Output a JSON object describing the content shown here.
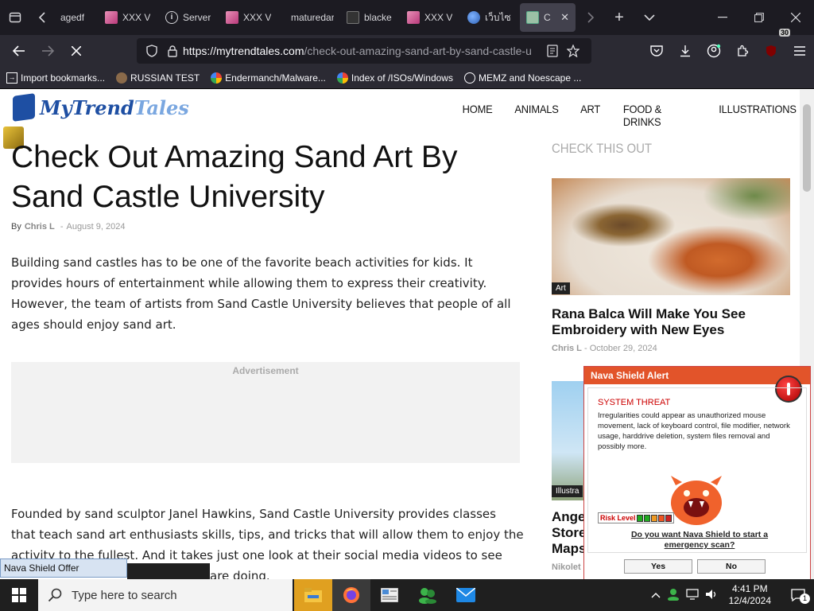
{
  "browser": {
    "tabs": [
      {
        "title": "agedf",
        "favicon": "none"
      },
      {
        "title": "XXX V",
        "favicon": "pink-image"
      },
      {
        "title": "Server",
        "favicon": "info-icon"
      },
      {
        "title": "XXX V",
        "favicon": "pink-image"
      },
      {
        "title": "maturedar",
        "favicon": "none"
      },
      {
        "title": "blacke",
        "favicon": "dark-image"
      },
      {
        "title": "XXX V",
        "favicon": "pink-image"
      },
      {
        "title": "เว็บไซ",
        "favicon": "globe"
      },
      {
        "title": "Che",
        "favicon": "image",
        "active": true
      }
    ],
    "url_host": "https://mytrendtales.com",
    "url_path": "/check-out-amazing-sand-art-by-sand-castle-u",
    "extension_badge": "30",
    "bookmarks": [
      {
        "label": "Import bookmarks...",
        "icon": "import-icon"
      },
      {
        "label": "RUSSIAN TEST",
        "icon": "circle-icon"
      },
      {
        "label": "Endermanch/Malware...",
        "icon": "google-icon"
      },
      {
        "label": "Index of /ISOs/Windows",
        "icon": "google-icon"
      },
      {
        "label": "MEMZ and Noescape ...",
        "icon": "globe-icon"
      }
    ]
  },
  "site": {
    "logo_part1": "MyTrend",
    "logo_part2": "Tales",
    "nav": [
      "HOME",
      "ANIMALS",
      "ART",
      "FOOD & DRINKS",
      "ILLUSTRATIONS"
    ]
  },
  "article": {
    "title": "Check Out Amazing Sand Art By Sand Castle University",
    "by": "By",
    "author": "Chris L",
    "sep": "-",
    "date": "August 9, 2024",
    "para1": "Building sand castles has to be one of the favorite beach activities for kids. It provides hours of entertainment while allowing them to express their creativity. However, the team of artists from Sand Castle University believes that people of all ages should enjoy sand art.",
    "ad_label": "Advertisement",
    "para2": "Founded by sand sculptor Janel Hawkins, Sand Castle University provides classes that teach sand art enthusiasts skills, tips, and tricks that will allow them to enjoy the activity to the fullest. And it takes just one look at their social media videos to see",
    "para2_tail": "are doing."
  },
  "sidebar": {
    "heading": "CHECK THIS OUT",
    "card1": {
      "tag": "Art",
      "title": "Rana Balca Will Make You See Embroidery with New Eyes",
      "author": "Chris L",
      "sep": "-",
      "date": "October 29, 2024"
    },
    "card2": {
      "tag": "Illustra",
      "title_lines": [
        "Ange",
        "Store",
        "Maps"
      ],
      "author": "Nikolet"
    }
  },
  "popup": {
    "title": "Nava Shield Alert",
    "threat": "SYSTEM THREAT",
    "description": "Irregularities could appear as unauthorized mouse movement, lack of keyboard control, file modifier, network usage, harddrive deletion, system files removal and possibly more.",
    "risk_label": "Risk Level",
    "question": "Do you want Nava Shield to start a emergency scan?",
    "yes": "Yes",
    "no": "No",
    "offer_label": "Nava Shield Offer"
  },
  "taskbar": {
    "search_placeholder": "Type here to search",
    "time": "4:41 PM",
    "date": "12/4/2024",
    "notif_count": "1"
  },
  "colors": {
    "alert_orange": "#e2542a",
    "brand_blue": "#1e4fa3",
    "browser_dark": "#1c1b22"
  }
}
